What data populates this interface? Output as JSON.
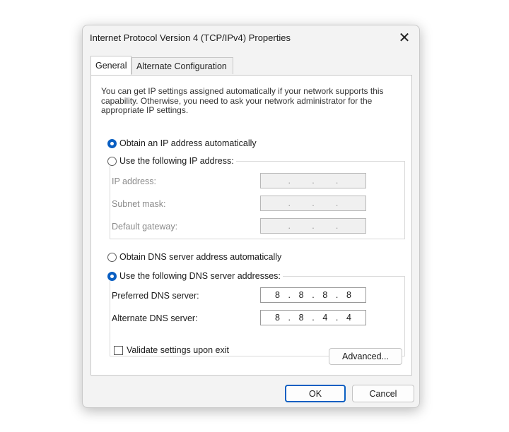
{
  "window": {
    "title": "Internet Protocol Version 4 (TCP/IPv4) Properties",
    "close_glyph": "✕"
  },
  "tabs": [
    {
      "label": "General",
      "active": true
    },
    {
      "label": "Alternate Configuration",
      "active": false
    }
  ],
  "general": {
    "description": "You can get IP settings assigned automatically if your network supports this capability. Otherwise, you need to ask your network administrator for the appropriate IP settings.",
    "ip": {
      "auto_label": "Obtain an IP address automatically",
      "auto_selected": true,
      "manual_label": "Use the following IP address:",
      "manual_selected": false,
      "fields": [
        {
          "label": "IP address:",
          "value": [
            " ",
            " ",
            " ",
            " "
          ]
        },
        {
          "label": "Subnet mask:",
          "value": [
            " ",
            " ",
            " ",
            " "
          ]
        },
        {
          "label": "Default gateway:",
          "value": [
            " ",
            " ",
            " ",
            " "
          ]
        }
      ]
    },
    "dns": {
      "auto_label": "Obtain DNS server address automatically",
      "auto_selected": false,
      "manual_label": "Use the following DNS server addresses:",
      "manual_selected": true,
      "fields": [
        {
          "label": "Preferred DNS server:",
          "value": [
            "8",
            "8",
            "8",
            "8"
          ]
        },
        {
          "label": "Alternate DNS server:",
          "value": [
            "8",
            "8",
            "4",
            "4"
          ]
        }
      ]
    },
    "validate_label": "Validate settings upon exit",
    "validate_checked": false,
    "advanced_label": "Advanced..."
  },
  "footer": {
    "ok_label": "OK",
    "cancel_label": "Cancel"
  },
  "colors": {
    "accent": "#0a5fc2",
    "dialog_bg": "#f3f3f3",
    "panel_bg": "#ffffff"
  }
}
